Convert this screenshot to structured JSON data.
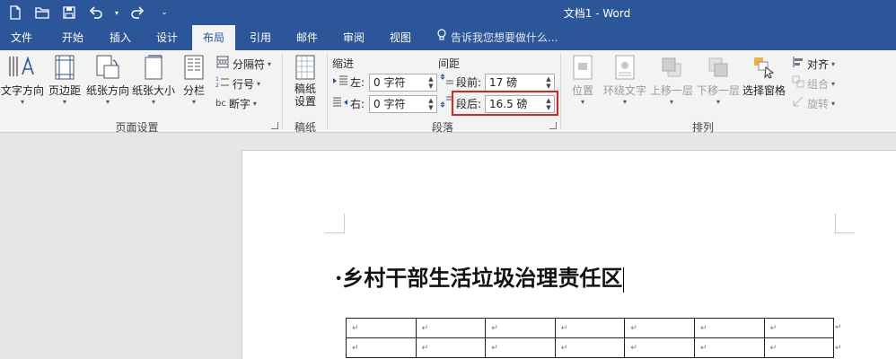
{
  "window": {
    "title": "文档1 - Word"
  },
  "qat": {
    "icons": [
      "new-doc-icon",
      "open-folder-icon",
      "save-icon",
      "undo-icon",
      "redo-icon",
      "customize-qat-icon"
    ]
  },
  "tabs": [
    {
      "label": "文件"
    },
    {
      "label": "开始"
    },
    {
      "label": "插入"
    },
    {
      "label": "设计"
    },
    {
      "label": "布局"
    },
    {
      "label": "引用"
    },
    {
      "label": "邮件"
    },
    {
      "label": "审阅"
    },
    {
      "label": "视图"
    }
  ],
  "tell_me": {
    "text": "告诉我您想要做什么..."
  },
  "page_setup": {
    "group_label": "页面设置",
    "text_direction": "文字方向",
    "margins": "页边距",
    "orientation": "纸张方向",
    "size": "纸张大小",
    "columns": "分栏",
    "breaks": "分隔符",
    "line_numbers": "行号",
    "hyphenation": "断字"
  },
  "paper": {
    "group_label": "稿纸",
    "button": "稿纸\n设置",
    "button_line1": "稿纸",
    "button_line2": "设置"
  },
  "paragraph": {
    "group_label": "段落",
    "indent_title": "缩进",
    "spacing_title": "间距",
    "indent_left_label": "左:",
    "indent_left_value": "0 字符",
    "indent_right_label": "右:",
    "indent_right_value": "0 字符",
    "spacing_before_label": "段前:",
    "spacing_before_value": "17 磅",
    "spacing_after_label": "段后:",
    "spacing_after_value": "16.5 磅"
  },
  "arrange": {
    "group_label": "排列",
    "position": "位置",
    "wrap_text": "环绕文字",
    "bring_forward": "上移一层",
    "send_backward": "下移一层",
    "selection_pane": "选择窗格",
    "align": "对齐",
    "group": "组合",
    "rotate": "旋转"
  },
  "document": {
    "heading": "·乡村干部生活垃圾治理责任区",
    "table": {
      "rows": [
        [
          "↵",
          "↵",
          "↵",
          "↵",
          "↵",
          "↵",
          "↵"
        ],
        [
          "↵",
          "↵",
          "↵",
          "↵",
          "↵",
          "↵",
          "↵"
        ]
      ],
      "row_end_mark": "↵"
    }
  }
}
